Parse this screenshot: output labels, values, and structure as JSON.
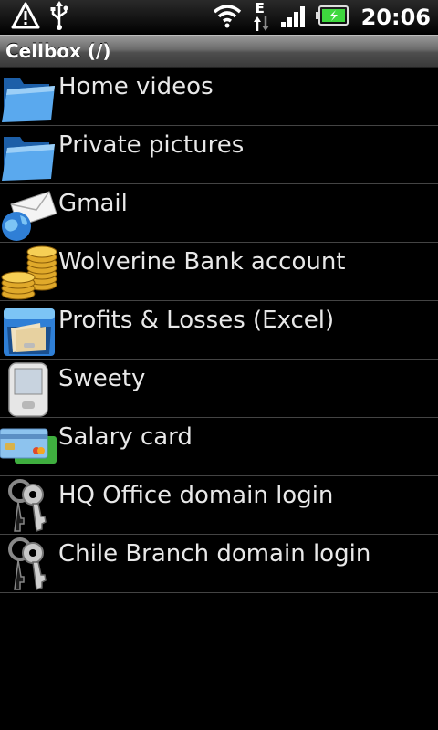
{
  "status": {
    "time": "20:06",
    "network_type": "E",
    "icons": [
      "warning-icon",
      "usb-icon",
      "wifi-icon",
      "data-transfer-icon",
      "signal-icon",
      "battery-icon"
    ]
  },
  "title": "Cellbox (/)",
  "colors": {
    "accent_folder": "#3e8fd8",
    "divider": "#444444",
    "battery": "#3ed83e"
  },
  "items": [
    {
      "label": "Home videos",
      "icon": "folder-icon"
    },
    {
      "label": "Private pictures",
      "icon": "folder-icon"
    },
    {
      "label": "Gmail",
      "icon": "mail-globe-icon"
    },
    {
      "label": "Wolverine Bank account",
      "icon": "coins-icon"
    },
    {
      "label": "Profits & Losses (Excel)",
      "icon": "file-cabinet-icon"
    },
    {
      "label": "Sweety",
      "icon": "pda-icon"
    },
    {
      "label": "Salary card",
      "icon": "credit-cards-icon"
    },
    {
      "label": "HQ Office domain login",
      "icon": "keys-icon"
    },
    {
      "label": "Chile Branch domain login",
      "icon": "keys-icon"
    }
  ]
}
